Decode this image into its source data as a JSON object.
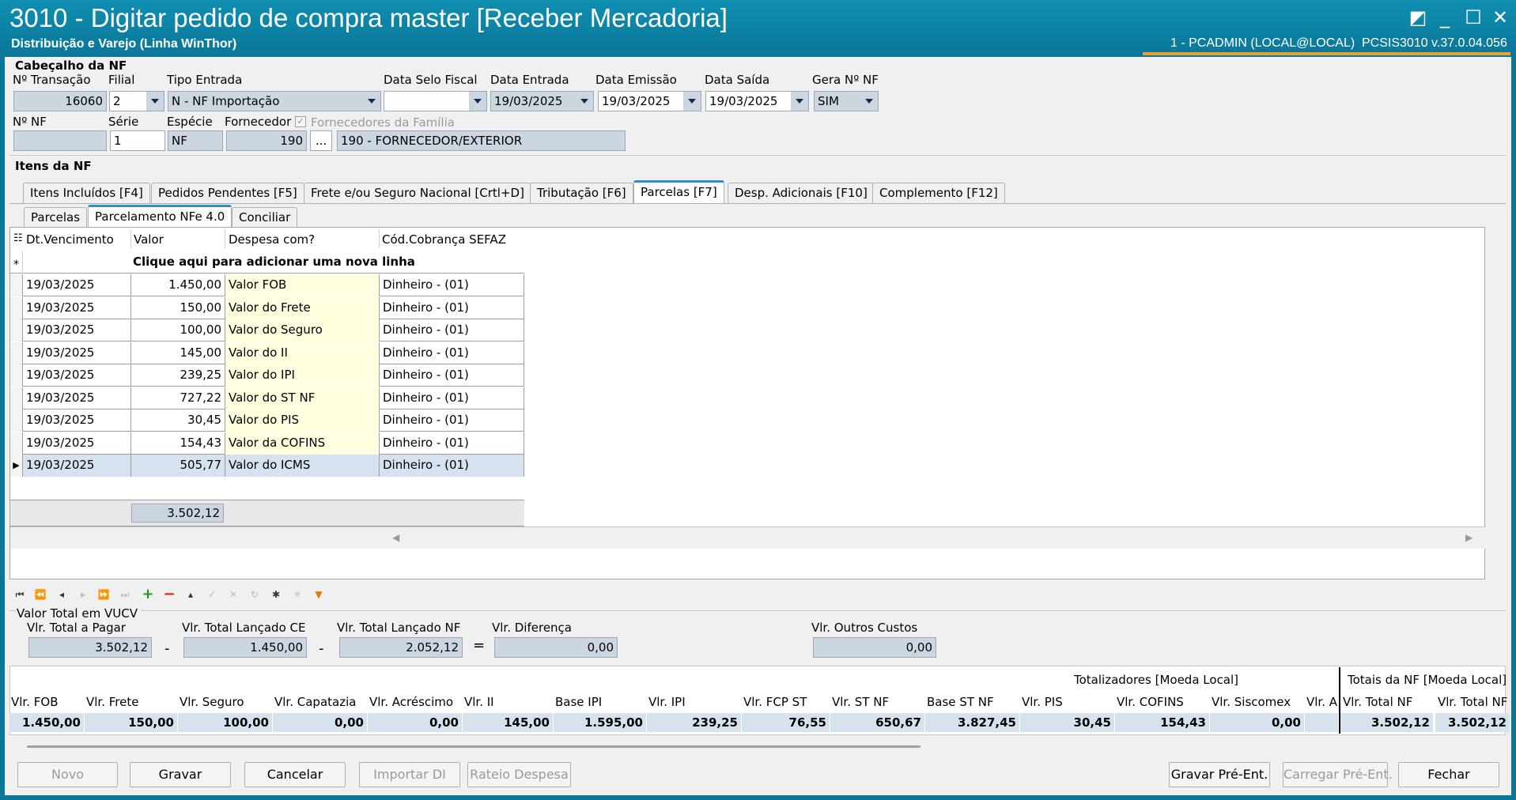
{
  "window": {
    "title": "3010 - Digitar pedido de compra master [Receber Mercadoria]",
    "subtitle": "Distribuição e Varejo (Linha WinThor)",
    "user_info": "1 - PCADMIN (LOCAL@LOCAL)",
    "version_info": "PCSIS3010  v.37.0.04.056"
  },
  "header": {
    "section_title": "Cabeçalho da NF",
    "transacao_label": "Nº Transação",
    "transacao_value": "16060",
    "filial_label": "Filial",
    "filial_value": "2",
    "tipo_entrada_label": "Tipo Entrada",
    "tipo_entrada_value": "N - NF Importação",
    "data_selo_label": "Data Selo Fiscal",
    "data_selo_value": "",
    "data_entrada_label": "Data Entrada",
    "data_entrada_value": "19/03/2025",
    "data_emissao_label": "Data Emissão",
    "data_emissao_value": "19/03/2025",
    "data_saida_label": "Data Saída",
    "data_saida_value": "19/03/2025",
    "gera_nf_label": "Gera Nº NF",
    "gera_nf_value": "SIM",
    "num_nf_label": "Nº NF",
    "num_nf_value": "",
    "serie_label": "Série",
    "serie_value": "1",
    "especie_label": "Espécie",
    "especie_value": "NF",
    "fornecedor_label": "Fornecedor",
    "fornecedor_code": "190",
    "fornecedor_btn": "...",
    "fornecedor_name": "190 - FORNECEDOR/EXTERIOR",
    "familia_label": "Fornecedores da Família"
  },
  "itens": {
    "section_title": "Itens da NF",
    "tabs": [
      "Itens Incluídos [F4]",
      "Pedidos Pendentes [F5]",
      "Frete e/ou Seguro Nacional [Crtl+D]",
      "Tributação [F6]",
      "Parcelas [F7]",
      "Desp. Adicionais [F10]",
      "Complemento [F12]"
    ],
    "subtabs": [
      "Parcelas",
      "Parcelamento NFe 4.0",
      "Conciliar"
    ]
  },
  "grid": {
    "columns": [
      "Dt.Vencimento",
      "Valor",
      "Despesa com?",
      "Cód.Cobrança SEFAZ"
    ],
    "new_row_text": "Clique aqui para adicionar uma nova linha",
    "new_row_marker": "*",
    "rows": [
      {
        "date": "19/03/2025",
        "valor": "1.450,00",
        "despesa": "Valor FOB",
        "cod": "Dinheiro - (01)"
      },
      {
        "date": "19/03/2025",
        "valor": "150,00",
        "despesa": "Valor do Frete",
        "cod": "Dinheiro - (01)"
      },
      {
        "date": "19/03/2025",
        "valor": "100,00",
        "despesa": "Valor do Seguro",
        "cod": "Dinheiro - (01)"
      },
      {
        "date": "19/03/2025",
        "valor": "145,00",
        "despesa": "Valor do II",
        "cod": "Dinheiro - (01)"
      },
      {
        "date": "19/03/2025",
        "valor": "239,25",
        "despesa": "Valor do IPI",
        "cod": "Dinheiro - (01)"
      },
      {
        "date": "19/03/2025",
        "valor": "727,22",
        "despesa": "Valor do ST NF",
        "cod": "Dinheiro - (01)"
      },
      {
        "date": "19/03/2025",
        "valor": "30,45",
        "despesa": "Valor do PIS",
        "cod": "Dinheiro - (01)"
      },
      {
        "date": "19/03/2025",
        "valor": "154,43",
        "despesa": "Valor da COFINS",
        "cod": "Dinheiro - (01)"
      },
      {
        "date": "19/03/2025",
        "valor": "505,77",
        "despesa": "Valor do ICMS",
        "cod": "Dinheiro - (01)"
      }
    ],
    "sum_value": "3.502,12"
  },
  "vucv": {
    "group_label": "Valor Total em VUCV",
    "total_pagar_label": "Vlr. Total a Pagar",
    "total_pagar_value": "3.502,12",
    "lancado_ce_label": "Vlr. Total Lançado CE",
    "lancado_ce_value": "1.450,00",
    "lancado_nf_label": "Vlr. Total Lançado NF",
    "lancado_nf_value": "2.052,12",
    "diferenca_label": "Vlr. Diferença",
    "diferenca_value": "0,00",
    "outros_label": "Vlr. Outros Custos",
    "outros_value": "0,00",
    "minus": "-",
    "equals": "="
  },
  "totals": {
    "group_local": "Totalizadores [Moeda Local]",
    "group_nf": "Totais da NF [Moeda Local]",
    "columns": [
      {
        "label": "Vlr. FOB",
        "value": "1.450,00"
      },
      {
        "label": "Vlr. Frete",
        "value": "150,00"
      },
      {
        "label": "Vlr. Seguro",
        "value": "100,00"
      },
      {
        "label": "Vlr. Capatazia",
        "value": "0,00"
      },
      {
        "label": "Vlr. Acréscimo",
        "value": "0,00"
      },
      {
        "label": "Vlr. II",
        "value": "145,00"
      },
      {
        "label": "Base IPI",
        "value": "1.595,00"
      },
      {
        "label": "Vlr. IPI",
        "value": "239,25"
      },
      {
        "label": "Vlr. FCP ST",
        "value": "76,55"
      },
      {
        "label": "Vlr. ST NF",
        "value": "650,67"
      },
      {
        "label": "Base ST NF",
        "value": "3.827,45"
      },
      {
        "label": "Vlr. PIS",
        "value": "30,45"
      },
      {
        "label": "Vlr. COFINS",
        "value": "154,43"
      },
      {
        "label": "Vlr. Siscomex",
        "value": "0,00"
      },
      {
        "label": "Vlr. A",
        "value": ""
      }
    ],
    "nf_columns": [
      {
        "label": "Vlr. Total NF",
        "value": "3.502,12"
      },
      {
        "label": "Vlr. Total NF",
        "value": "3.502,12"
      }
    ]
  },
  "buttons": {
    "novo": "Novo",
    "gravar": "Gravar",
    "cancelar": "Cancelar",
    "importar_di": "Importar DI",
    "rateio": "Rateio Despesa",
    "gravar_pre": "Gravar Pré-Ent.",
    "carregar_pre": "Carregar Pré-Ent.",
    "fechar": "Fechar"
  }
}
